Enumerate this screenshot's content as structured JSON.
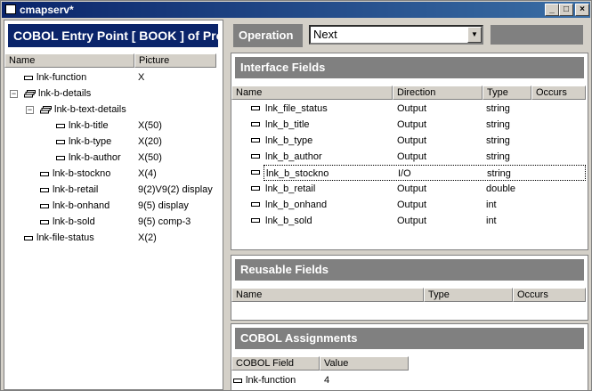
{
  "window": {
    "title": "cmapserv*",
    "min": "_",
    "max": "□",
    "close": "×"
  },
  "left": {
    "header": "COBOL Entry Point [ BOOK ] of Prog",
    "columns": {
      "name": "Name",
      "picture": "Picture"
    },
    "items": [
      {
        "name": "lnk-function",
        "picture": "X",
        "kind": "field",
        "level": 0
      },
      {
        "name": "lnk-b-details",
        "picture": "",
        "kind": "group",
        "level": 0
      },
      {
        "name": "lnk-b-text-details",
        "picture": "",
        "kind": "group",
        "level": 1
      },
      {
        "name": "lnk-b-title",
        "picture": "X(50)",
        "kind": "field",
        "level": 2
      },
      {
        "name": "lnk-b-type",
        "picture": "X(20)",
        "kind": "field",
        "level": 2
      },
      {
        "name": "lnk-b-author",
        "picture": "X(50)",
        "kind": "field",
        "level": 2
      },
      {
        "name": "lnk-b-stockno",
        "picture": "X(4)",
        "kind": "field",
        "level": 1
      },
      {
        "name": "lnk-b-retail",
        "picture": "9(2)V9(2) display",
        "kind": "field",
        "level": 1
      },
      {
        "name": "lnk-b-onhand",
        "picture": "9(5) display",
        "kind": "field",
        "level": 1
      },
      {
        "name": "lnk-b-sold",
        "picture": "9(5) comp-3",
        "kind": "field",
        "level": 1
      },
      {
        "name": "lnk-file-status",
        "picture": "X(2)",
        "kind": "field",
        "level": 0
      }
    ]
  },
  "operation": {
    "label": "Operation",
    "value": "Next"
  },
  "interface": {
    "title": "Interface Fields",
    "columns": {
      "name": "Name",
      "direction": "Direction",
      "type": "Type",
      "occurs": "Occurs"
    },
    "rows": [
      {
        "name": "lnk_file_status",
        "direction": "Output",
        "type": "string",
        "occurs": ""
      },
      {
        "name": "lnk_b_title",
        "direction": "Output",
        "type": "string",
        "occurs": ""
      },
      {
        "name": "lnk_b_type",
        "direction": "Output",
        "type": "string",
        "occurs": ""
      },
      {
        "name": "lnk_b_author",
        "direction": "Output",
        "type": "string",
        "occurs": ""
      },
      {
        "name": "lnk_b_stockno",
        "direction": "I/O",
        "type": "string",
        "occurs": ""
      },
      {
        "name": "lnk_b_retail",
        "direction": "Output",
        "type": "double",
        "occurs": ""
      },
      {
        "name": "lnk_b_onhand",
        "direction": "Output",
        "type": "int",
        "occurs": ""
      },
      {
        "name": "lnk_b_sold",
        "direction": "Output",
        "type": "int",
        "occurs": ""
      }
    ]
  },
  "reusable": {
    "title": "Reusable Fields",
    "columns": {
      "name": "Name",
      "type": "Type",
      "occurs": "Occurs"
    }
  },
  "assignments": {
    "title": "COBOL Assignments",
    "columns": {
      "field": "COBOL Field",
      "value": "Value"
    },
    "rows": [
      {
        "field": "lnk-function",
        "value": "4"
      }
    ]
  },
  "icons": {
    "field": "field-icon",
    "group": "group-icon",
    "dropdown": "chevron-down-icon"
  }
}
